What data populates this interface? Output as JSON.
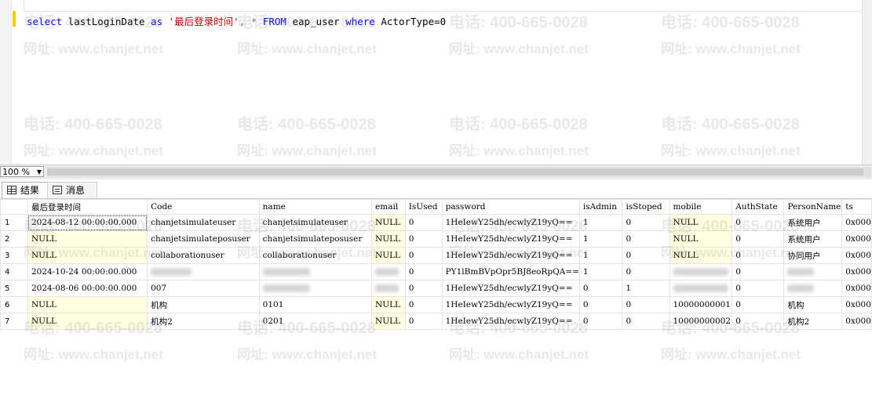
{
  "editor": {
    "query_tokens": [
      {
        "t": "select",
        "c": "kw"
      },
      {
        "t": " lastLoginDate ",
        "c": ""
      },
      {
        "t": "as",
        "c": "kw"
      },
      {
        "t": " ",
        "c": ""
      },
      {
        "t": "'最后登录时间'",
        "c": "str"
      },
      {
        "t": ", ",
        "c": "gr"
      },
      {
        "t": "* ",
        "c": "gr"
      },
      {
        "t": "FROM",
        "c": "kw"
      },
      {
        "t": " eap_user ",
        "c": ""
      },
      {
        "t": "where",
        "c": "kw"
      },
      {
        "t": " ActorType=0",
        "c": ""
      }
    ]
  },
  "zoom": {
    "value": "100 %"
  },
  "tabs": {
    "results": "结果",
    "messages": "消息"
  },
  "watermark": {
    "phone": "电话: 400-665-0028",
    "site": "网址: www.chanjet.net"
  },
  "grid": {
    "columns": [
      "",
      "最后登录时间",
      "Code",
      "name",
      "email",
      "IsUsed",
      "password",
      "isAdmin",
      "isStoped",
      "mobile",
      "AuthState",
      "PersonName",
      "ts"
    ],
    "rows": [
      [
        "1",
        "2024-08-12 00:00:00.000",
        "chanjetsimulateuser",
        "chanjetsimulateuser",
        "NULL",
        "0",
        "1HeIewY25dh/ecwlyZ19yQ==",
        "1",
        "0",
        "NULL",
        "0",
        "系统用户",
        "0x000"
      ],
      [
        "2",
        "NULL",
        "chanjetsimulateposuser",
        "chanjetsimulateposuser",
        "NULL",
        "0",
        "1HeIewY25dh/ecwlyZ19yQ==",
        "1",
        "0",
        "NULL",
        "0",
        "系统用户",
        "0x000"
      ],
      [
        "3",
        "NULL",
        "collaborationuser",
        "collaborationuser",
        "NULL",
        "0",
        "1HeIewY25dh/ecwlyZ19yQ==",
        "1",
        "0",
        "NULL",
        "0",
        "协同用户",
        "0x000"
      ],
      [
        "4",
        "2024-10-24 00:00:00.000",
        "",
        "",
        "",
        "0",
        "PY1lBmBVpOpr5BJ8eoRpQA==",
        "1",
        "0",
        "",
        "0",
        "",
        "0x000"
      ],
      [
        "5",
        "2024-08-06 00:00:00.000",
        "007",
        "",
        "",
        "0",
        "1HeIewY25dh/ecwlyZ19yQ==",
        "0",
        "1",
        "",
        "0",
        "",
        "0x000"
      ],
      [
        "6",
        "NULL",
        "机构",
        "0101",
        "NULL",
        "0",
        "1HeIewY25dh/ecwlyZ19yQ==",
        "0",
        "0",
        "10000000001",
        "0",
        "机构",
        "0x000"
      ],
      [
        "7",
        "NULL",
        "机构2",
        "0201",
        "NULL",
        "0",
        "1HeIewY25dh/ecwlyZ19yQ==",
        "0",
        "0",
        "10000000002",
        "0",
        "机构2",
        "0x000"
      ]
    ]
  }
}
